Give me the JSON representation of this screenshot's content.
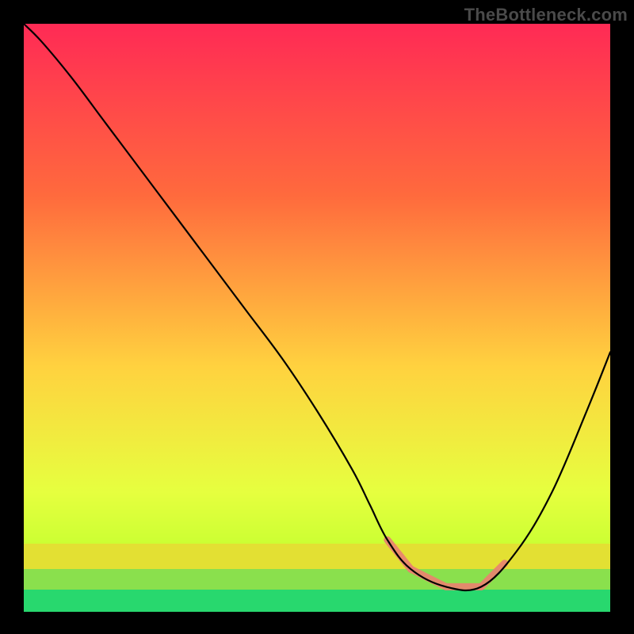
{
  "watermark": "TheBottleneck.com",
  "colors": {
    "gradient_top": "#ff2a55",
    "gradient_mid1": "#ff6a3d",
    "gradient_mid2": "#ffd23f",
    "gradient_low": "#e6ff3f",
    "band_yellow": "#e3e033",
    "band_green1": "#8ae04d",
    "band_green2": "#28d86e",
    "curve": "#000000",
    "highlight": "#e9826f"
  },
  "chart_data": {
    "type": "line",
    "title": "",
    "xlabel": "",
    "ylabel": "",
    "xlim": [
      0,
      100
    ],
    "ylim": [
      0,
      100
    ],
    "x": [
      0,
      3,
      8,
      14,
      20,
      26,
      32,
      38,
      44,
      50,
      56,
      59,
      62,
      66,
      72,
      78,
      84,
      90,
      96,
      100
    ],
    "y": [
      100,
      97,
      91,
      83,
      75,
      67,
      59,
      51,
      43,
      34,
      24,
      18,
      12,
      7,
      4,
      4,
      10,
      20,
      34,
      44
    ],
    "series": [
      {
        "name": "bottleneck-curve",
        "x": [
          0,
          3,
          8,
          14,
          20,
          26,
          32,
          38,
          44,
          50,
          56,
          59,
          62,
          66,
          72,
          78,
          84,
          90,
          96,
          100
        ],
        "y": [
          100,
          97,
          91,
          83,
          75,
          67,
          59,
          51,
          43,
          34,
          24,
          18,
          12,
          7,
          4,
          4,
          10,
          20,
          34,
          44
        ]
      }
    ],
    "highlight_ranges": [
      {
        "x0": 62,
        "x1": 66
      },
      {
        "x0": 66,
        "x1": 78
      },
      {
        "x0": 78,
        "x1": 82
      }
    ]
  }
}
